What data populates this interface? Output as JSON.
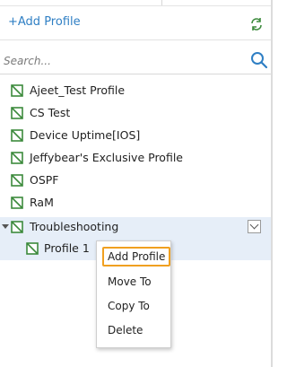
{
  "header": {
    "add_profile_label": "+Add Profile"
  },
  "search": {
    "placeholder": "Search..."
  },
  "tree": {
    "items": [
      {
        "label": "Ajeet_Test Profile"
      },
      {
        "label": "CS Test"
      },
      {
        "label": "Device Uptime[IOS]"
      },
      {
        "label": "Jeffybear's Exclusive Profile"
      },
      {
        "label": "OSPF"
      },
      {
        "label": "RaM"
      },
      {
        "label": "Troubleshooting",
        "expanded": true,
        "selected": true
      }
    ],
    "children": [
      {
        "label": "Profile 1"
      }
    ]
  },
  "context_menu": {
    "items": [
      {
        "label": "Add Profile",
        "highlighted": true
      },
      {
        "label": "Move To"
      },
      {
        "label": "Copy To"
      },
      {
        "label": "Delete"
      }
    ]
  },
  "colors": {
    "link": "#2f7fc4",
    "icon_green": "#3c8a3c",
    "selected_bg": "#e6eef8",
    "highlight_border": "#f0a020"
  },
  "icons": [
    "refresh-icon",
    "search-icon",
    "profile-icon",
    "expand-icon",
    "chevron-down-icon"
  ]
}
